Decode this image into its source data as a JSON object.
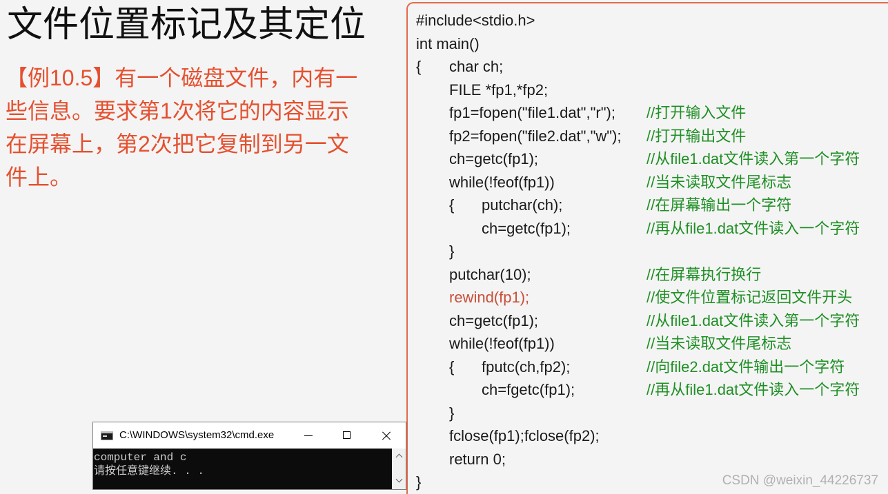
{
  "slide": {
    "title": "文件位置标记及其定位",
    "example_lines": [
      "【例10.5】有一个磁盘文件，内有一",
      "些信息。要求第1次将它的内容显示",
      "在屏幕上，第2次把它复制到另一文",
      "件上。"
    ],
    "colors": {
      "background": "#f4f4f4",
      "title": "#111111",
      "example_text": "#e5502f"
    }
  },
  "code_panel": {
    "lines": [
      {
        "code": "#include<stdio.h>"
      },
      {
        "code": "int main()"
      },
      {
        "brace": "{",
        "code": "char ch;"
      },
      {
        "code": "FILE *fp1,*fp2;"
      },
      {
        "code": "fp1=fopen(\"file1.dat\",\"r\");",
        "comment": "//打开输入文件"
      },
      {
        "code": "fp2=fopen(\"file2.dat\",\"w\");",
        "comment": "//打开输出文件"
      },
      {
        "code": "ch=getc(fp1);",
        "comment": "//从file1.dat文件读入第一个字符"
      },
      {
        "code": "while(!feof(fp1))",
        "comment": "//当未读取文件尾标志"
      },
      {
        "brace": "{",
        "code": "putchar(ch);",
        "comment": "//在屏幕输出一个字符"
      },
      {
        "code": "ch=getc(fp1);",
        "comment": "//再从file1.dat文件读入一个字符"
      },
      {
        "brace": "}"
      },
      {
        "code": "putchar(10);",
        "comment": "//在屏幕执行换行"
      },
      {
        "code": "rewind(fp1);",
        "comment": "//使文件位置标记返回文件开头"
      },
      {
        "code": "ch=getc(fp1);",
        "comment": "//从file1.dat文件读入第一个字符"
      },
      {
        "code": "while(!feof(fp1))",
        "comment": "//当未读取文件尾标志"
      },
      {
        "brace": "{",
        "code": "fputc(ch,fp2);",
        "comment": "//向file2.dat文件输出一个字符"
      },
      {
        "code": "ch=fgetc(fp1);",
        "comment": "//再从file1.dat文件读入一个字符"
      },
      {
        "brace": "}"
      },
      {
        "code": "fclose(fp1);fclose(fp2);"
      },
      {
        "code": "return 0;"
      },
      {
        "brace": "}"
      }
    ],
    "colors": {
      "border": "#e36a4c",
      "code_text": "#1a1a1a",
      "comment": "#1f8f25",
      "highlight": "#c94f3a"
    }
  },
  "cmd_window": {
    "title": "C:\\WINDOWS\\system32\\cmd.exe",
    "icon": "cmd-icon",
    "controls": {
      "minimize": "minimize-icon",
      "maximize": "maximize-icon",
      "close": "close-icon"
    },
    "output": [
      "computer and c",
      "请按任意键继续. . ."
    ],
    "scrollbar": {
      "up": "scroll-up-arrow-icon",
      "down": "scroll-down-arrow-icon"
    },
    "colors": {
      "console_bg": "#0c0c0c",
      "console_text": "#cccccc"
    }
  },
  "watermark": {
    "text": "CSDN @weixin_44226737",
    "color": "#b0b0b0"
  }
}
